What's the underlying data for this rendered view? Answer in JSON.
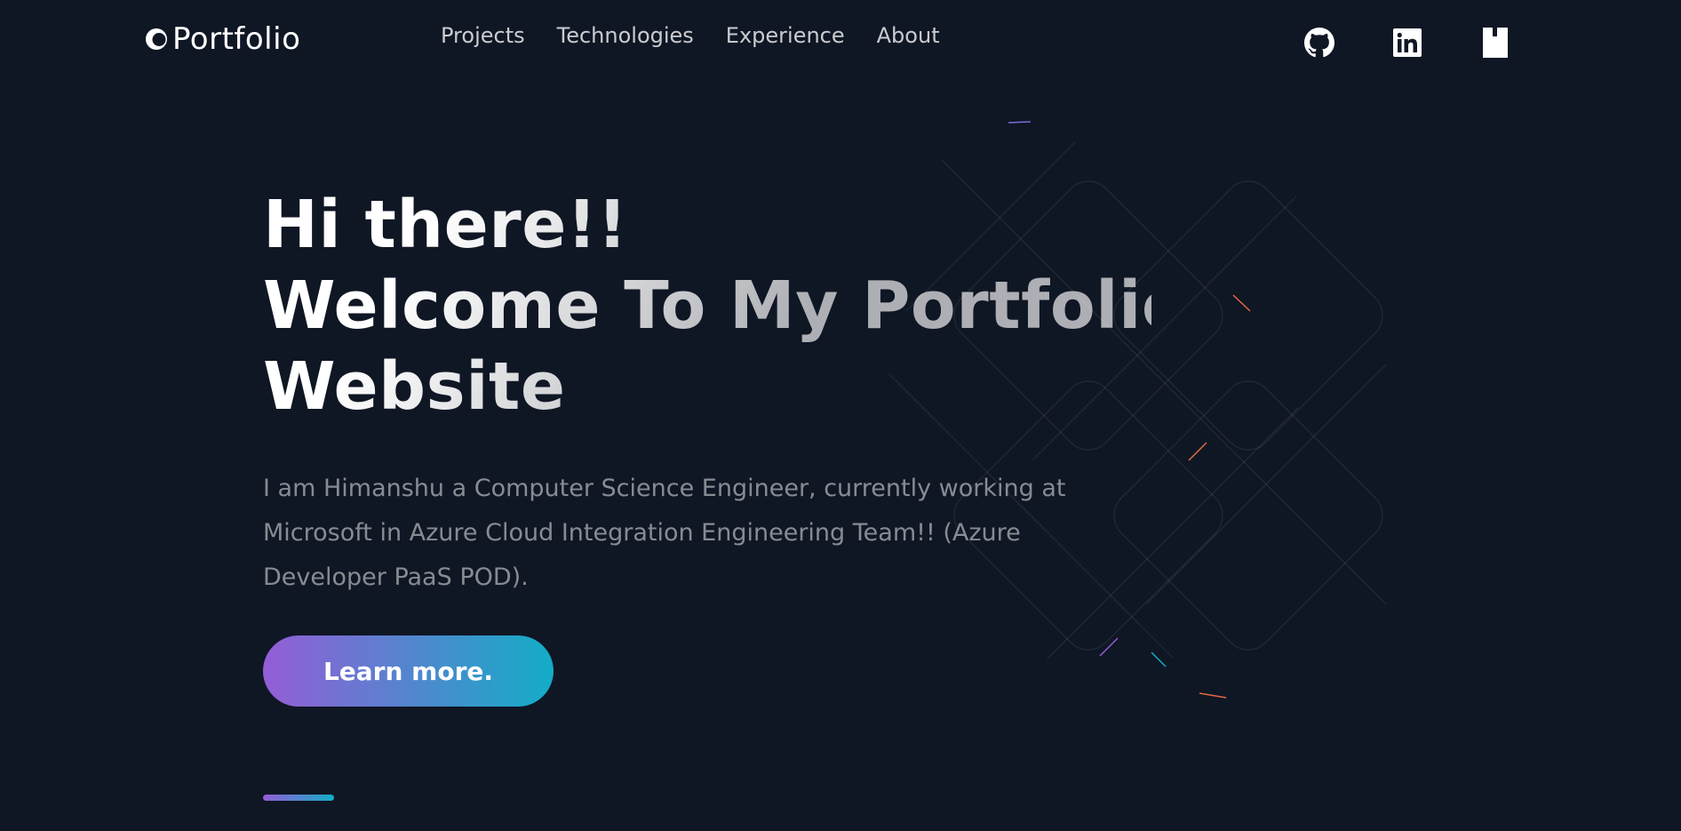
{
  "header": {
    "logo_text": "Portfolio",
    "nav": [
      {
        "label": "Projects"
      },
      {
        "label": "Technologies"
      },
      {
        "label": "Experience"
      },
      {
        "label": "About"
      }
    ],
    "social_icons": [
      "github-icon",
      "linkedin-icon",
      "resume-icon"
    ]
  },
  "hero": {
    "title_line1": "Hi there!!",
    "title_line2": "Welcome To My Portfolio",
    "title_line3": "Website",
    "description": "I am Himanshu a Computer Science Engineer, currently working at Microsoft in Azure Cloud Integration Engineering Team!! (Azure Developer PaaS POD).",
    "cta_label": "Learn more."
  },
  "colors": {
    "background": "#0f1624",
    "gradient_start": "#945dd6",
    "gradient_end": "#13adc7",
    "text": "#ffffff"
  }
}
